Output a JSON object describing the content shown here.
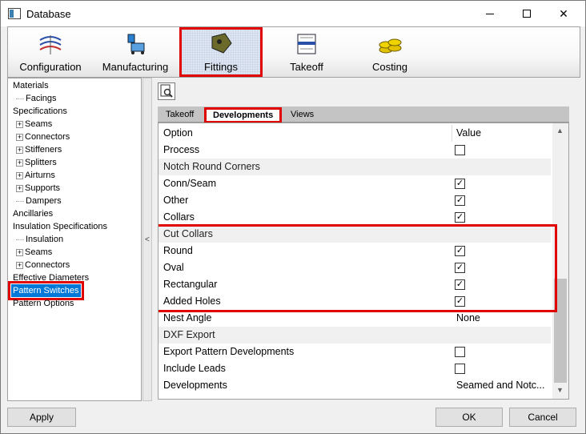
{
  "window": {
    "title": "Database"
  },
  "ribbon": {
    "tabs": [
      {
        "label": "Configuration",
        "icon": "configuration-icon"
      },
      {
        "label": "Manufacturing",
        "icon": "manufacturing-icon"
      },
      {
        "label": "Fittings",
        "icon": "fittings-icon",
        "active": true
      },
      {
        "label": "Takeoff",
        "icon": "takeoff-icon"
      },
      {
        "label": "Costing",
        "icon": "costing-icon"
      }
    ]
  },
  "tree": {
    "items": [
      {
        "label": "Materials"
      },
      {
        "label": "Facings"
      },
      {
        "label": "Specifications"
      },
      {
        "label": "Seams"
      },
      {
        "label": "Connectors"
      },
      {
        "label": "Stiffeners"
      },
      {
        "label": "Splitters"
      },
      {
        "label": "Airturns"
      },
      {
        "label": "Supports"
      },
      {
        "label": "Dampers"
      },
      {
        "label": "Ancillaries"
      },
      {
        "label": "Insulation Specifications"
      },
      {
        "label": "Insulation"
      },
      {
        "label": "Seams"
      },
      {
        "label": "Connectors"
      },
      {
        "label": "Effective Diameters"
      },
      {
        "label": "Pattern Switches"
      },
      {
        "label": "Pattern Options"
      }
    ]
  },
  "splitter": {
    "glyph": "<"
  },
  "subtabs": [
    "Takeoff",
    "Developments",
    "Views"
  ],
  "grid": {
    "header": {
      "option": "Option",
      "value": "Value"
    },
    "rows": [
      {
        "option": "Process",
        "checked": false
      },
      {
        "option": "Notch Round Corners"
      },
      {
        "option": "Conn/Seam",
        "checked": true
      },
      {
        "option": "Other",
        "checked": true
      },
      {
        "option": "Collars",
        "checked": true
      },
      {
        "option": "Cut Collars"
      },
      {
        "option": "Round",
        "checked": true
      },
      {
        "option": "Oval",
        "checked": true
      },
      {
        "option": "Rectangular",
        "checked": true
      },
      {
        "option": "Added Holes",
        "checked": true
      },
      {
        "option": "Nest Angle",
        "text": "None"
      },
      {
        "option": "DXF Export"
      },
      {
        "option": "Export Pattern Developments",
        "checked": false
      },
      {
        "option": "Include Leads",
        "checked": false
      },
      {
        "option": "Developments",
        "text": "Seamed and Notc..."
      }
    ]
  },
  "buttons": {
    "apply": "Apply",
    "ok": "OK",
    "cancel": "Cancel"
  },
  "colors": {
    "highlight_red": "#e00000",
    "selection_blue": "#0078d7"
  }
}
